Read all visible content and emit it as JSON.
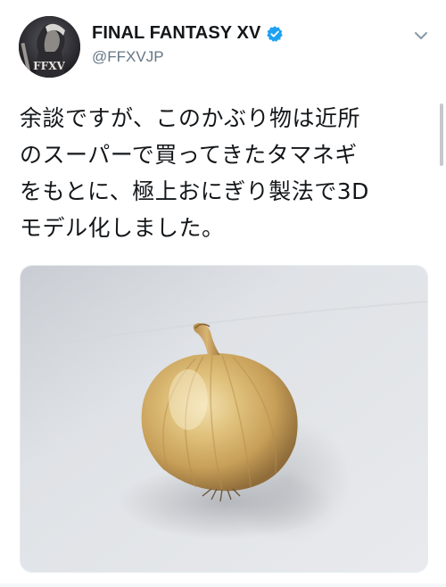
{
  "tweet": {
    "author": {
      "display_name": "FINAL FANTASY XV",
      "handle": "@FFXVJP",
      "verified": true,
      "avatar_text": "FFXV"
    },
    "text": "余談ですが、このかぶり物は近所\nのスーパーで買ってきたタマネギ\nをもとに、極上おにぎり製法で3D\nモデル化しました。",
    "media": {
      "type": "photo",
      "subject": "onion"
    }
  },
  "icons": {
    "verified": "verified-badge-icon",
    "menu": "chevron-down-icon"
  },
  "colors": {
    "verified_blue": "#1da1f2",
    "secondary_text": "#657786",
    "primary_text": "#14171a"
  }
}
